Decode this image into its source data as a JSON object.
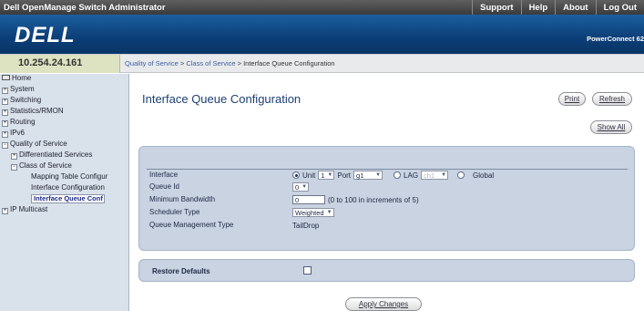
{
  "topbar": {
    "app_title": "Dell OpenManage Switch Administrator",
    "links": [
      "Support",
      "Help",
      "About",
      "Log Out"
    ]
  },
  "banner": {
    "logo": "DELL",
    "model": "PowerConnect 62"
  },
  "ipbar": {
    "ip": "10.254.24.161",
    "breadcrumb": [
      "Quality of Service",
      "Class of Service",
      "Interface Queue Configuration"
    ],
    "separator": " > "
  },
  "nav": {
    "items": [
      {
        "label": "Home",
        "icon": "home-icon"
      },
      {
        "label": "System",
        "icon": "expand-icon"
      },
      {
        "label": "Switching",
        "icon": "expand-icon"
      },
      {
        "label": "Statistics/RMON",
        "icon": "expand-icon"
      },
      {
        "label": "Routing",
        "icon": "expand-icon"
      },
      {
        "label": "IPv6",
        "icon": "expand-icon"
      },
      {
        "label": "Quality of Service",
        "icon": "collapse-icon"
      },
      {
        "label": "Differentiated Services",
        "icon": "expand-icon"
      },
      {
        "label": "Class of Service",
        "icon": "collapse-icon"
      },
      {
        "label": "Mapping Table Configur"
      },
      {
        "label": "Interface Configuration"
      },
      {
        "label": "Interface Queue Conf",
        "selected": true
      },
      {
        "label": "IP Multicast",
        "icon": "expand-icon"
      }
    ]
  },
  "page": {
    "title": "Interface Queue Configuration",
    "print_label": "Print",
    "refresh_label": "Refresh",
    "show_all_label": "Show All",
    "apply_label": "Apply Changes"
  },
  "form": {
    "interface": {
      "label": "Interface",
      "unit_label": "Unit",
      "unit_value": "1",
      "port_label": "Port",
      "port_value": "g1",
      "lag_label": "LAG",
      "lag_value": "ch1",
      "global_label": "Global"
    },
    "queue_id": {
      "label": "Queue Id",
      "value": "0"
    },
    "min_bandwidth": {
      "label": "Minimum Bandwidth",
      "value": "0",
      "hint": "(0 to 100 in increments of 5)"
    },
    "scheduler_type": {
      "label": "Scheduler Type",
      "value": "Weighted"
    },
    "queue_mgmt": {
      "label": "Queue Management Type",
      "value": "TailDrop"
    },
    "restore_defaults": {
      "label": "Restore Defaults",
      "checked": false
    }
  },
  "colors": {
    "banner": "#0c3e77",
    "panel": "#c9d3e1",
    "nav": "#d9e1ea",
    "title": "#1d3f73"
  }
}
